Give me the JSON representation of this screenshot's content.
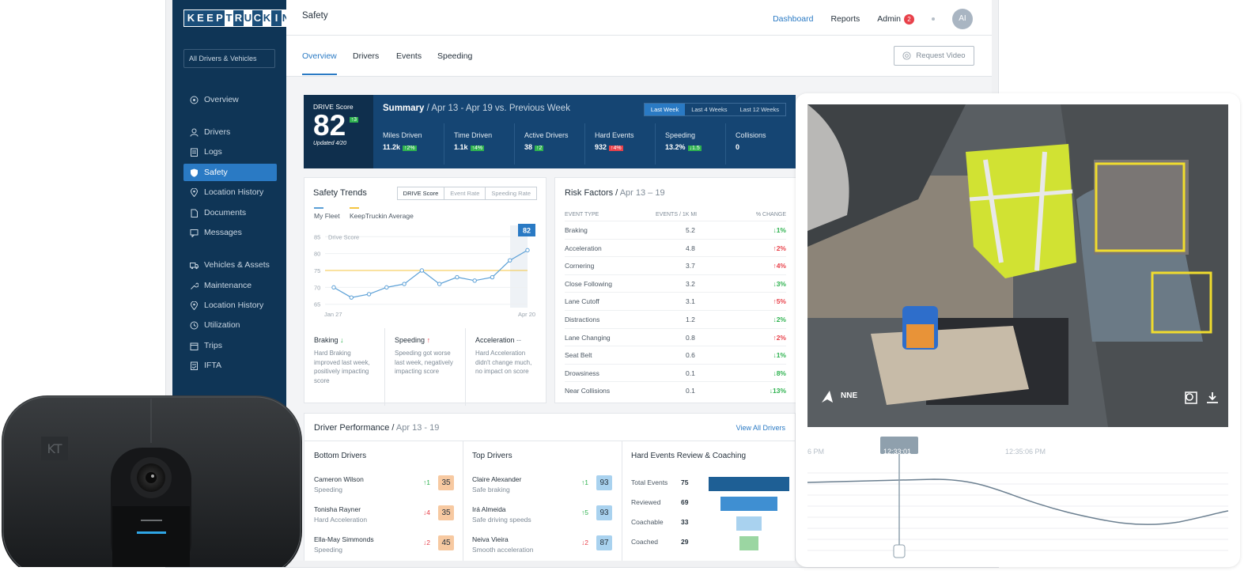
{
  "app": {
    "logo_letters": [
      "K",
      "E",
      "E",
      "P",
      "T",
      "R",
      "U",
      "C",
      "K",
      "I",
      "N"
    ],
    "page_title": "Safety",
    "filter_label": "All Drivers & Vehicles"
  },
  "topnav": {
    "dashboard": "Dashboard",
    "reports": "Reports",
    "admin": "Admin",
    "admin_badge": "2",
    "avatar": "AI"
  },
  "sidebar": {
    "items": [
      {
        "label": "Overview",
        "icon": "dashboard-icon"
      },
      {
        "label": "Drivers",
        "icon": "user-icon"
      },
      {
        "label": "Logs",
        "icon": "logs-icon"
      },
      {
        "label": "Safety",
        "icon": "shield-icon",
        "active": true
      },
      {
        "label": "Location History",
        "icon": "pin-icon"
      },
      {
        "label": "Documents",
        "icon": "document-icon"
      },
      {
        "label": "Messages",
        "icon": "message-icon"
      },
      {
        "label": "Vehicles & Assets",
        "icon": "truck-icon"
      },
      {
        "label": "Maintenance",
        "icon": "wrench-icon"
      },
      {
        "label": "Location History",
        "icon": "pin-icon"
      },
      {
        "label": "Utilization",
        "icon": "clock-icon"
      },
      {
        "label": "Trips",
        "icon": "calendar-icon"
      },
      {
        "label": "IFTA",
        "icon": "ifta-icon"
      }
    ]
  },
  "subnav": {
    "tabs": [
      "Overview",
      "Drivers",
      "Events",
      "Speeding"
    ],
    "request_video": "Request Video"
  },
  "summary": {
    "drive_label": "DRIVE Score",
    "drive_score": "82",
    "drive_change": "↑3",
    "updated": "Updated 4/20",
    "title": "Summary",
    "range_text": "Apr 13 - Apr 19 vs. Previous Week",
    "range_tabs": [
      "Last Week",
      "Last 4 Weeks",
      "Last 12 Weeks"
    ],
    "metrics": [
      {
        "label": "Miles Driven",
        "value": "11.2k",
        "change": "↑2%",
        "dir": "g"
      },
      {
        "label": "Time Driven",
        "value": "1.1k",
        "change": "↑4%",
        "dir": "g"
      },
      {
        "label": "Active Drivers",
        "value": "38",
        "change": "↑2",
        "dir": "g"
      },
      {
        "label": "Hard Events",
        "value": "932",
        "change": "↑4%",
        "dir": "r"
      },
      {
        "label": "Speeding",
        "value": "13.2%",
        "change": "↓1.5",
        "dir": "g"
      },
      {
        "label": "Collisions",
        "value": "0",
        "change": "",
        "dir": ""
      }
    ]
  },
  "safety_trends": {
    "title": "Safety Trends",
    "segments": [
      "DRIVE Score",
      "Event Rate",
      "Speeding Rate"
    ],
    "legend_my_fleet": "My Fleet",
    "legend_avg": "KeepTruckin Average",
    "current_value": "82",
    "cards": [
      {
        "title": "Braking",
        "arrow": "↓",
        "dir": "g",
        "text": "Hard Braking improved last week, positively impacting score"
      },
      {
        "title": "Speeding",
        "arrow": "↑",
        "dir": "r",
        "text": "Speeding got worse last week, negatively impacting score"
      },
      {
        "title": "Acceleration",
        "arrow": "--",
        "dir": "n",
        "text": "Hard Acceleration didn't change much, no impact on score"
      }
    ]
  },
  "chart_data": {
    "type": "line",
    "ylabel": "Drive Score",
    "y_ticks": [
      "85",
      "80",
      "75",
      "70",
      "65"
    ],
    "x_tick_labels": [
      "Jan 27",
      "Apr 20"
    ],
    "ylim": [
      64,
      86
    ],
    "series": [
      {
        "name": "My Fleet",
        "values": [
          70,
          67,
          68,
          70,
          71,
          75,
          71,
          73,
          72,
          73,
          78,
          81
        ]
      },
      {
        "name": "KeepTruckin Average",
        "values": [
          75,
          75,
          75,
          75,
          75,
          75,
          75,
          75,
          75,
          75,
          75,
          75
        ]
      }
    ],
    "colors": {
      "fleet": "#5a9fd6",
      "avg": "#f4c542"
    }
  },
  "risk_factors": {
    "title": "Risk Factors",
    "range": "Apr 13 – 19",
    "headers": [
      "EVENT TYPE",
      "EVENTS / 1K MI",
      "% CHANGE"
    ],
    "rows": [
      {
        "name": "Braking",
        "value": "5.2",
        "change": "↓1%",
        "dir": "g"
      },
      {
        "name": "Acceleration",
        "value": "4.8",
        "change": "↑2%",
        "dir": "r"
      },
      {
        "name": "Cornering",
        "value": "3.7",
        "change": "↑4%",
        "dir": "r"
      },
      {
        "name": "Close Following",
        "value": "3.2",
        "change": "↓3%",
        "dir": "g"
      },
      {
        "name": "Lane Cutoff",
        "value": "3.1",
        "change": "↑5%",
        "dir": "r"
      },
      {
        "name": "Distractions",
        "value": "1.2",
        "change": "↓2%",
        "dir": "g"
      },
      {
        "name": "Lane Changing",
        "value": "0.8",
        "change": "↑2%",
        "dir": "r"
      },
      {
        "name": "Seat Belt",
        "value": "0.6",
        "change": "↓1%",
        "dir": "g"
      },
      {
        "name": "Drowsiness",
        "value": "0.1",
        "change": "↓8%",
        "dir": "g"
      },
      {
        "name": "Near Collisions",
        "value": "0.1",
        "change": "↓13%",
        "dir": "g"
      }
    ]
  },
  "driver_performance": {
    "title": "Driver Performance",
    "range": "Apr 13 - 19",
    "view_all": "View All Drivers",
    "bottom_title": "Bottom Drivers",
    "top_title": "Top Drivers",
    "bottom": [
      {
        "name": "Cameron Wilson",
        "sub": "Speeding",
        "change": "↑1",
        "dir": "g",
        "score": "35"
      },
      {
        "name": "Tonisha Rayner",
        "sub": "Hard Acceleration",
        "change": "↓4",
        "dir": "r",
        "score": "35"
      },
      {
        "name": "Ella-May Simmonds",
        "sub": "Speeding",
        "change": "↓2",
        "dir": "r",
        "score": "45"
      }
    ],
    "top": [
      {
        "name": "Claire Alexander",
        "sub": "Safe braking",
        "change": "↑1",
        "dir": "g",
        "score": "93"
      },
      {
        "name": "Irá Almeida",
        "sub": "Safe driving speeds",
        "change": "↑5",
        "dir": "g",
        "score": "93"
      },
      {
        "name": "Neiva Vieira",
        "sub": "Smooth acceleration",
        "change": "↓2",
        "dir": "r",
        "score": "87"
      }
    ],
    "hard_events_title": "Hard Events Review & Coaching",
    "funnel": [
      {
        "label": "Total Events",
        "value": "75"
      },
      {
        "label": "Reviewed",
        "value": "69"
      },
      {
        "label": "Coachable",
        "value": "33"
      },
      {
        "label": "Coached",
        "value": "29"
      }
    ]
  },
  "camera_device": {
    "logo": "KT"
  },
  "video": {
    "heading": "NNE",
    "timeline_labels": [
      "6 PM",
      "12:33:01",
      "12:35:06 PM"
    ]
  }
}
